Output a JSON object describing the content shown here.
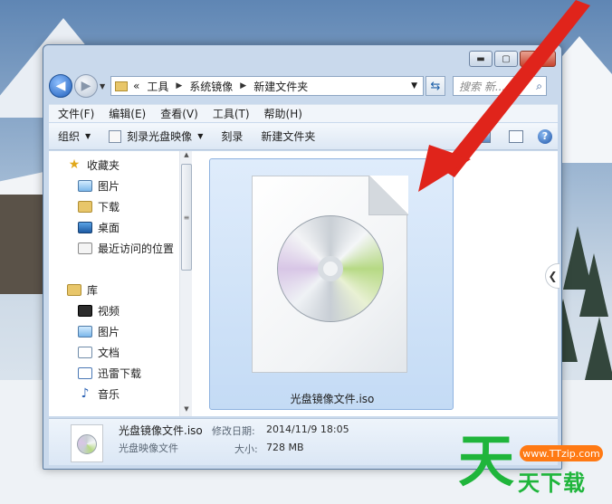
{
  "window": {
    "controls": {
      "minimize": "▬",
      "maximize": "▢",
      "close": "✕"
    }
  },
  "address_bar": {
    "prefix": "«",
    "crumbs": [
      "工具",
      "系统镜像",
      "新建文件夹"
    ],
    "search_placeholder": "搜索 新...",
    "search_icon": "magnifier-icon"
  },
  "menu": [
    "文件(F)",
    "编辑(E)",
    "查看(V)",
    "工具(T)",
    "帮助(H)"
  ],
  "toolbar": {
    "organize": "组织",
    "burn_image": "刻录光盘映像",
    "burn": "刻录",
    "new_folder": "新建文件夹",
    "help": "?"
  },
  "nav": {
    "favorites": "收藏夹",
    "favorites_items": [
      "图片",
      "下载",
      "桌面",
      "最近访问的位置"
    ],
    "libraries": "库",
    "library_items": [
      "视频",
      "图片",
      "文档",
      "迅雷下载",
      "音乐"
    ]
  },
  "file": {
    "name": "光盘镜像文件.iso",
    "type": "光盘映像文件",
    "modified_label": "修改日期:",
    "modified_value": "2014/11/9 18:05",
    "size_label": "大小:",
    "size_value": "728 MB"
  },
  "watermark": {
    "big_char": "天",
    "url": "www.TTzip.com",
    "text": "天下载"
  },
  "colors": {
    "arrow": "#e0241b",
    "watermark_green": "#1fb53b",
    "watermark_orange": "#ff7a14"
  }
}
